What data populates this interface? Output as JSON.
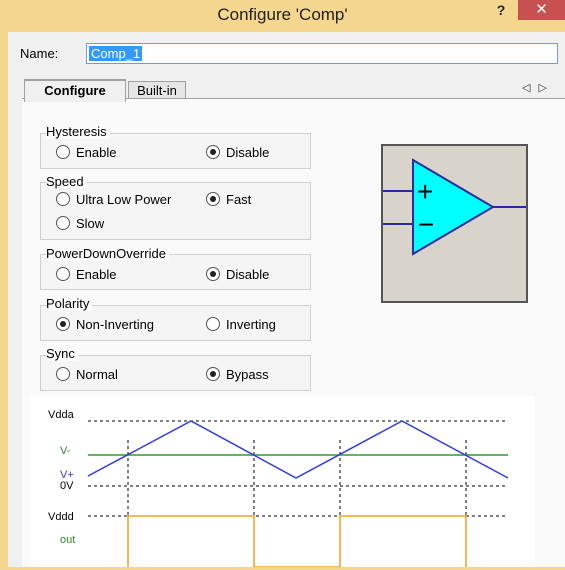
{
  "window": {
    "title": "Configure 'Comp'",
    "help": "?",
    "close": "✕"
  },
  "name_field": {
    "label": "Name:",
    "value": "Comp_1"
  },
  "tabs": [
    {
      "label": "Configure"
    },
    {
      "label": "Built-in"
    }
  ],
  "tab_nav": {
    "left": "◁",
    "right": "▷"
  },
  "groups": {
    "hysteresis": {
      "label": "Hysteresis",
      "options": [
        "Enable",
        "Disable"
      ],
      "selected": "Disable"
    },
    "speed": {
      "label": "Speed",
      "options": [
        "Ultra Low Power",
        "Fast",
        "Slow"
      ],
      "selected": "Fast"
    },
    "powerdown": {
      "label": "PowerDownOverride",
      "options": [
        "Enable",
        "Disable"
      ],
      "selected": "Disable"
    },
    "polarity": {
      "label": "Polarity",
      "options": [
        "Non-Inverting",
        "Inverting"
      ],
      "selected": "Non-Inverting"
    },
    "sync": {
      "label": "Sync",
      "options": [
        "Normal",
        "Bypass"
      ],
      "selected": "Bypass"
    }
  },
  "symbol": {
    "plus": "+",
    "minus": "−",
    "body_color": "#00ffff",
    "wire_color": "#2b2b9c"
  },
  "waveform": {
    "labels": {
      "vdda": "Vdda",
      "vminus": "V-",
      "vplus": "V+",
      "zero": "0V",
      "vddd": "Vddd",
      "out": "out"
    },
    "colors": {
      "triangle": "#2b3fd9",
      "vminus": "#2e9e2e",
      "out": "#f0a020",
      "label_green": "#2e8b2e",
      "label_blue": "#2b3fd9"
    }
  }
}
